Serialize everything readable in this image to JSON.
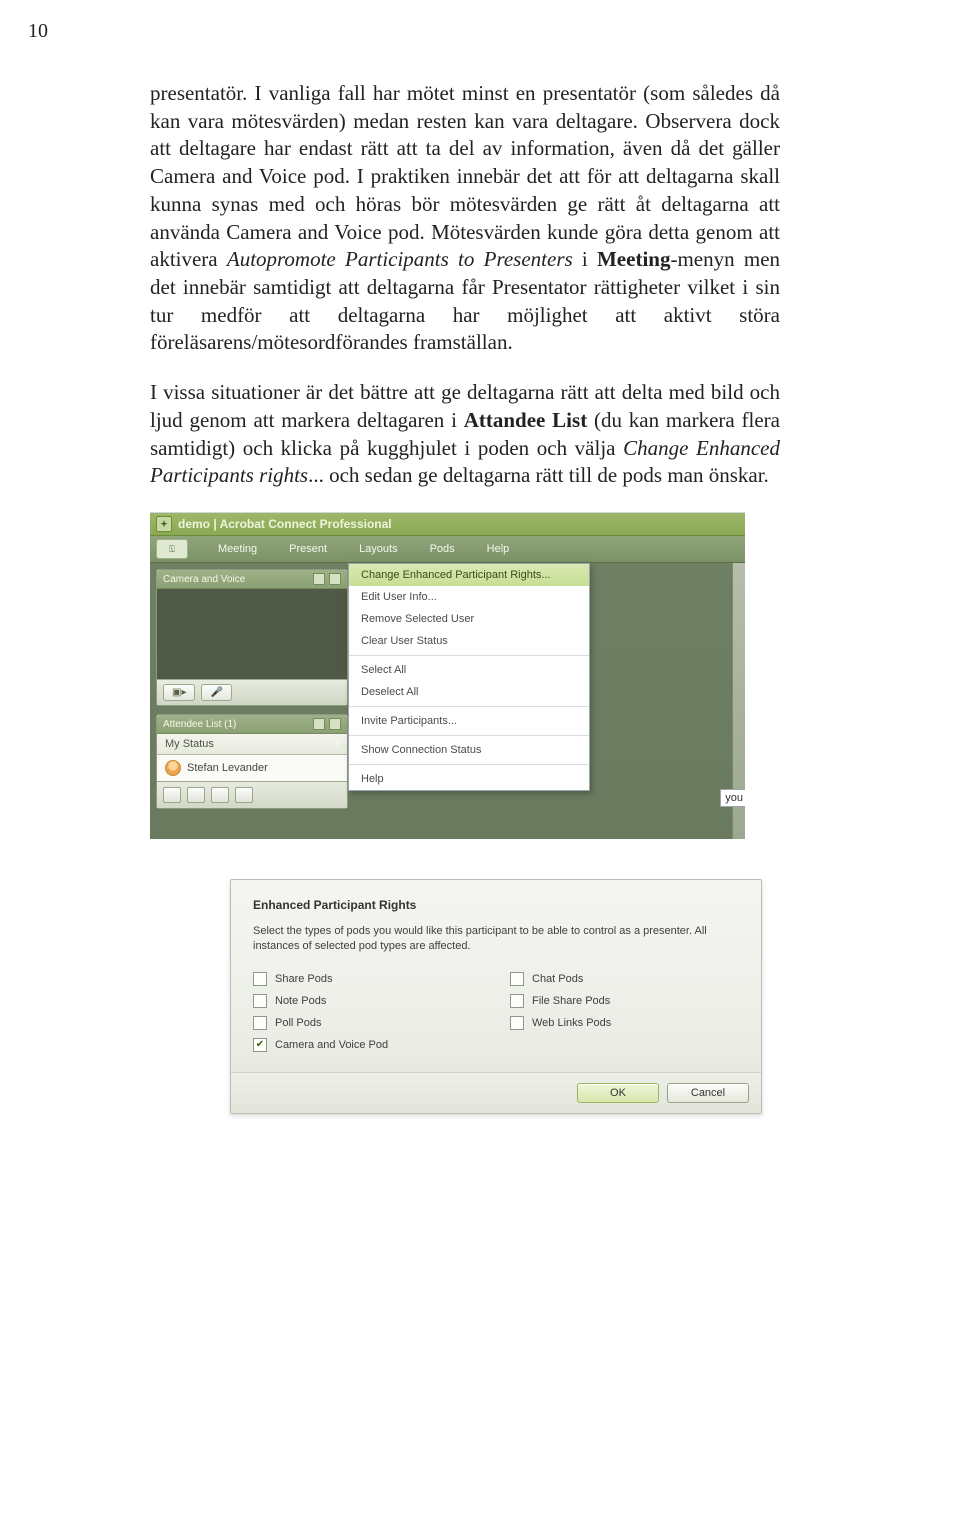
{
  "page_number": "10",
  "paragraphs": {
    "p1_html": "presentatör. I vanliga fall har mötet minst en presentatör (som således då kan vara mötesvärden) medan resten kan vara deltagare. Observera dock att deltagare har endast rätt att ta del av information, även då det gäller Camera and Voice pod. I praktiken innebär det att för att deltagarna skall kunna synas med och höras bör mötesvärden ge rätt åt deltagarna att använda Camera and Voice pod. Mötesvärden kunde göra detta genom att aktivera <em>Autopromote Participants to Presenters</em> i <strong>Meeting</strong>-menyn men det innebär samtidigt att deltagarna får Presentator rättigheter vilket i sin tur medför att deltagarna har möjlighet att aktivt störa föreläsarens/mötesordförandes framställan.",
    "p2_html": "I vissa situationer är det bättre att ge deltagarna rätt att delta med bild och ljud genom att markera deltagaren i <strong>Attandee List</strong> (du kan markera flera samtidigt) och klicka på kugghjulet i poden och välja <em>Change Enhanced Participants rights</em>... och sedan ge deltagarna rätt till de pods man önskar."
  },
  "app": {
    "title": "demo  |  Acrobat Connect Professional",
    "menu": [
      "Meeting",
      "Present",
      "Layouts",
      "Pods",
      "Help"
    ],
    "camera_pod_title": "Camera and Voice",
    "cam_buttons": {
      "cam": "▣▸",
      "talk": "🎤"
    },
    "attendee_pod_title": "Attendee List (1)",
    "my_status": "My Status",
    "participant": "Stefan Levander",
    "you_label": "you",
    "popup": {
      "highlight": "Change Enhanced Participant Rights...",
      "items_a": [
        "Edit User Info...",
        "Remove Selected User",
        "Clear User Status"
      ],
      "items_b": [
        "Select All",
        "Deselect All"
      ],
      "items_c": [
        "Invite Participants..."
      ],
      "items_d": [
        "Show Connection Status"
      ],
      "items_e": [
        "Help"
      ]
    }
  },
  "dialog": {
    "title": "Enhanced Participant Rights",
    "desc": "Select the types of pods you would like this participant to be able to control as a presenter. All instances of selected pod types are affected.",
    "options": [
      {
        "label": "Share Pods",
        "checked": false
      },
      {
        "label": "Chat Pods",
        "checked": false
      },
      {
        "label": "Note Pods",
        "checked": false
      },
      {
        "label": "File Share Pods",
        "checked": false
      },
      {
        "label": "Poll Pods",
        "checked": false
      },
      {
        "label": "Web Links Pods",
        "checked": false
      },
      {
        "label": "Camera and Voice Pod",
        "checked": true
      }
    ],
    "ok": "OK",
    "cancel": "Cancel"
  }
}
